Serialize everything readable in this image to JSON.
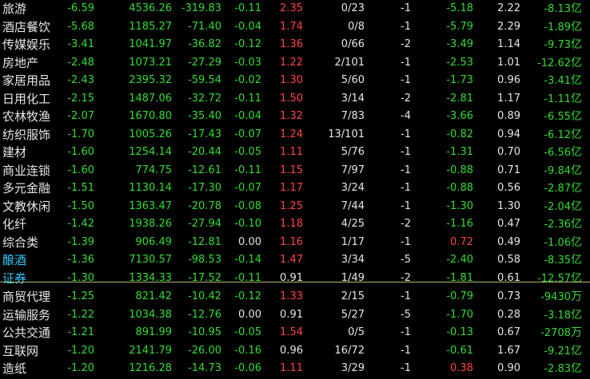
{
  "colors": {
    "background": "#000000",
    "up": "#ff4444",
    "down": "#33dd33",
    "neutral": "#e6e6e6",
    "highlight_name": "#33ccff",
    "divider": "#b8b86a"
  },
  "rows": [
    {
      "name": "旅游",
      "pct": "-6.59",
      "price": "4536.26",
      "chg": "-319.83",
      "speed": "-0.11",
      "ratio": "2.35",
      "updown": "0/23",
      "lead": "-1",
      "c8": "-5.18",
      "c8c": "green",
      "c9": "2.22",
      "amt": "-8.13",
      "unit": "亿",
      "hl": false
    },
    {
      "name": "酒店餐饮",
      "pct": "-5.68",
      "price": "1185.27",
      "chg": "-71.40",
      "speed": "-0.04",
      "ratio": "1.74",
      "updown": "0/8",
      "lead": "-1",
      "c8": "-5.79",
      "c8c": "green",
      "c9": "2.29",
      "amt": "-1.89",
      "unit": "亿",
      "hl": false
    },
    {
      "name": "传媒娱乐",
      "pct": "-3.41",
      "price": "1041.97",
      "chg": "-36.82",
      "speed": "-0.12",
      "ratio": "1.36",
      "updown": "0/66",
      "lead": "-2",
      "c8": "-3.49",
      "c8c": "green",
      "c9": "1.14",
      "amt": "-9.73",
      "unit": "亿",
      "hl": false
    },
    {
      "name": "房地产",
      "pct": "-2.48",
      "price": "1073.21",
      "chg": "-27.29",
      "speed": "-0.03",
      "ratio": "1.22",
      "updown": "2/101",
      "lead": "-1",
      "c8": "-2.53",
      "c8c": "green",
      "c9": "1.01",
      "amt": "-12.62",
      "unit": "亿",
      "hl": false
    },
    {
      "name": "家居用品",
      "pct": "-2.43",
      "price": "2395.32",
      "chg": "-59.54",
      "speed": "-0.02",
      "ratio": "1.30",
      "updown": "5/60",
      "lead": "-1",
      "c8": "-1.73",
      "c8c": "green",
      "c9": "0.96",
      "amt": "-3.41",
      "unit": "亿",
      "hl": false
    },
    {
      "name": "日用化工",
      "pct": "-2.15",
      "price": "1487.06",
      "chg": "-32.72",
      "speed": "-0.11",
      "ratio": "1.50",
      "updown": "3/14",
      "lead": "-2",
      "c8": "-2.81",
      "c8c": "green",
      "c9": "1.17",
      "amt": "-1.11",
      "unit": "亿",
      "hl": false
    },
    {
      "name": "农林牧渔",
      "pct": "-2.07",
      "price": "1670.80",
      "chg": "-35.40",
      "speed": "-0.04",
      "ratio": "1.32",
      "updown": "7/83",
      "lead": "-4",
      "c8": "-3.66",
      "c8c": "green",
      "c9": "0.89",
      "amt": "-6.55",
      "unit": "亿",
      "hl": false
    },
    {
      "name": "纺织服饰",
      "pct": "-1.70",
      "price": "1005.26",
      "chg": "-17.43",
      "speed": "-0.07",
      "ratio": "1.24",
      "updown": "13/101",
      "lead": "-1",
      "c8": "-0.82",
      "c8c": "green",
      "c9": "0.94",
      "amt": "-6.12",
      "unit": "亿",
      "hl": false
    },
    {
      "name": "建材",
      "pct": "-1.60",
      "price": "1254.14",
      "chg": "-20.44",
      "speed": "-0.05",
      "ratio": "1.11",
      "updown": "5/76",
      "lead": "-1",
      "c8": "-1.31",
      "c8c": "green",
      "c9": "0.70",
      "amt": "-6.56",
      "unit": "亿",
      "hl": false
    },
    {
      "name": "商业连锁",
      "pct": "-1.60",
      "price": "774.75",
      "chg": "-12.61",
      "speed": "-0.11",
      "ratio": "1.15",
      "updown": "7/97",
      "lead": "-1",
      "c8": "-0.88",
      "c8c": "green",
      "c9": "0.71",
      "amt": "-9.84",
      "unit": "亿",
      "hl": false
    },
    {
      "name": "多元金融",
      "pct": "-1.51",
      "price": "1130.14",
      "chg": "-17.30",
      "speed": "-0.07",
      "ratio": "1.17",
      "updown": "3/24",
      "lead": "-1",
      "c8": "-0.88",
      "c8c": "green",
      "c9": "0.56",
      "amt": "-2.87",
      "unit": "亿",
      "hl": false
    },
    {
      "name": "文教休闲",
      "pct": "-1.50",
      "price": "1363.47",
      "chg": "-20.78",
      "speed": "-0.08",
      "ratio": "1.25",
      "updown": "7/44",
      "lead": "-1",
      "c8": "-1.30",
      "c8c": "green",
      "c9": "1.30",
      "amt": "-2.04",
      "unit": "亿",
      "hl": false
    },
    {
      "name": "化纤",
      "pct": "-1.42",
      "price": "1938.26",
      "chg": "-27.94",
      "speed": "-0.10",
      "ratio": "1.18",
      "updown": "4/25",
      "lead": "-2",
      "c8": "-1.16",
      "c8c": "green",
      "c9": "0.47",
      "amt": "-2.36",
      "unit": "亿",
      "hl": false
    },
    {
      "name": "综合类",
      "pct": "-1.39",
      "price": "906.49",
      "chg": "-12.81",
      "speed": "0.00",
      "ratio": "1.16",
      "updown": "1/17",
      "lead": "-1",
      "c8": "0.72",
      "c8c": "red",
      "c9": "0.49",
      "amt": "-1.06",
      "unit": "亿",
      "hl": false
    },
    {
      "name": "酿酒",
      "pct": "-1.36",
      "price": "7130.57",
      "chg": "-98.53",
      "speed": "-0.14",
      "ratio": "1.47",
      "updown": "3/34",
      "lead": "-5",
      "c8": "-2.40",
      "c8c": "green",
      "c9": "0.58",
      "amt": "-8.35",
      "unit": "亿",
      "hl": true
    },
    {
      "name": "证券",
      "pct": "-1.30",
      "price": "1334.33",
      "chg": "-17.52",
      "speed": "-0.11",
      "ratio": "0.91",
      "updown": "1/49",
      "lead": "-2",
      "c8": "-1.81",
      "c8c": "green",
      "c9": "0.61",
      "amt": "-12.57",
      "unit": "亿",
      "hl": true
    },
    {
      "name": "商贸代理",
      "pct": "-1.25",
      "price": "821.42",
      "chg": "-10.42",
      "speed": "-0.12",
      "ratio": "1.33",
      "updown": "2/15",
      "lead": "-1",
      "c8": "-0.79",
      "c8c": "green",
      "c9": "0.73",
      "amt": "-9430",
      "unit": "万",
      "hl": false
    },
    {
      "name": "运输服务",
      "pct": "-1.22",
      "price": "1034.38",
      "chg": "-12.76",
      "speed": "0.00",
      "ratio": "0.91",
      "updown": "5/27",
      "lead": "-5",
      "c8": "-1.70",
      "c8c": "green",
      "c9": "0.28",
      "amt": "-3.18",
      "unit": "亿",
      "hl": false
    },
    {
      "name": "公共交通",
      "pct": "-1.21",
      "price": "891.99",
      "chg": "-10.95",
      "speed": "-0.05",
      "ratio": "1.54",
      "updown": "0/5",
      "lead": "-1",
      "c8": "-0.13",
      "c8c": "green",
      "c9": "0.67",
      "amt": "-2708",
      "unit": "万",
      "hl": false
    },
    {
      "name": "互联网",
      "pct": "-1.20",
      "price": "2141.79",
      "chg": "-26.00",
      "speed": "-0.16",
      "ratio": "0.96",
      "updown": "16/72",
      "lead": "-1",
      "c8": "-0.61",
      "c8c": "green",
      "c9": "1.67",
      "amt": "-9.21",
      "unit": "亿",
      "hl": false
    },
    {
      "name": "造纸",
      "pct": "-1.20",
      "price": "1216.28",
      "chg": "-14.73",
      "speed": "-0.06",
      "ratio": "1.11",
      "updown": "3/29",
      "lead": "-1",
      "c8": "0.38",
      "c8c": "red",
      "c9": "0.90",
      "amt": "-2.83",
      "unit": "亿",
      "hl": false
    }
  ]
}
